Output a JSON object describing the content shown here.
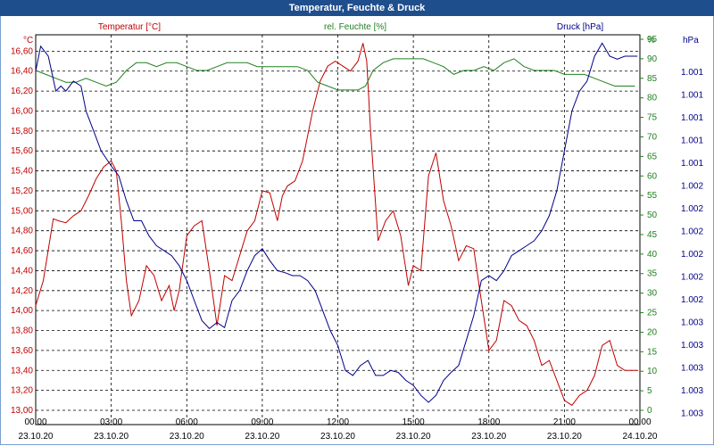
{
  "window": {
    "title": "Temperatur, Feuchte & Druck"
  },
  "colors": {
    "title_bar": "#1f4e8c",
    "temperature": "#c00000",
    "humidity": "#208020",
    "pressure": "#00008b",
    "grid": "#000000"
  },
  "chart_data": {
    "type": "line",
    "title": "Temperatur, Feuchte & Druck",
    "grid": true,
    "axes": {
      "temperature": {
        "label": "Temperatur [°C]",
        "unit": "°C",
        "side": "left",
        "ylim": [
          13.0,
          16.8
        ],
        "ticks": [
          "13,00",
          "13,20",
          "13,40",
          "13,60",
          "13,80",
          "14,00",
          "14,20",
          "14,40",
          "14,60",
          "14,80",
          "15,00",
          "15,20",
          "15,40",
          "15,60",
          "15,80",
          "16,00",
          "16,20",
          "16,40",
          "16,60"
        ]
      },
      "humidity": {
        "label": "rel. Feuchte [%]",
        "unit": "%",
        "side": "right-inner",
        "ylim": [
          0,
          95
        ],
        "ticks": [
          "0",
          "5",
          "10",
          "15",
          "20",
          "25",
          "30",
          "35",
          "40",
          "45",
          "50",
          "55",
          "60",
          "65",
          "70",
          "75",
          "80",
          "85",
          "90",
          "95"
        ]
      },
      "pressure": {
        "label": "Druck [hPa]",
        "unit": "hPa",
        "side": "right-outer",
        "ticks": [
          "1.001",
          "1.001",
          "1.001",
          "1.001",
          "1.001",
          "1.002",
          "1.002",
          "1.002",
          "1.002",
          "1.002",
          "1.002",
          "1.003",
          "1.003",
          "1.003",
          "1.003",
          "1.003"
        ]
      }
    },
    "x_ticks": [
      {
        "time": "00:00",
        "date": "23.10.20"
      },
      {
        "time": "03:00",
        "date": "23.10.20"
      },
      {
        "time": "06:00",
        "date": "23.10.20"
      },
      {
        "time": "09:00",
        "date": "23.10.20"
      },
      {
        "time": "12:00",
        "date": "23.10.20"
      },
      {
        "time": "15:00",
        "date": "23.10.20"
      },
      {
        "time": "18:00",
        "date": "23.10.20"
      },
      {
        "time": "21:00",
        "date": "23.10.20"
      },
      {
        "time": "00:00",
        "date": "24.10.20"
      }
    ],
    "x_unit": "hours since 23.10.20 00:00",
    "series": [
      {
        "name": "Temperatur [°C]",
        "axis": "temperature",
        "x": [
          0,
          0.3,
          0.7,
          0.9,
          1.2,
          1.5,
          1.8,
          2.1,
          2.4,
          2.7,
          3.0,
          3.2,
          3.4,
          3.6,
          3.8,
          4.1,
          4.4,
          4.7,
          5.0,
          5.3,
          5.5,
          5.7,
          6.0,
          6.3,
          6.6,
          6.9,
          7.2,
          7.5,
          7.8,
          8.1,
          8.4,
          8.7,
          9.0,
          9.3,
          9.6,
          9.8,
          10.0,
          10.3,
          10.6,
          11.0,
          11.3,
          11.6,
          11.9,
          12.2,
          12.5,
          12.8,
          13.0,
          13.15,
          13.3,
          13.6,
          13.9,
          14.2,
          14.5,
          14.8,
          15.0,
          15.3,
          15.6,
          15.9,
          16.2,
          16.5,
          16.8,
          17.1,
          17.4,
          17.7,
          18.0,
          18.3,
          18.6,
          18.9,
          19.2,
          19.5,
          19.8,
          20.1,
          20.4,
          20.7,
          21.0,
          21.3,
          21.6,
          21.9,
          22.2,
          22.5,
          22.8,
          23.1,
          23.4,
          23.7,
          23.9
        ],
        "y": [
          14.05,
          14.3,
          14.92,
          14.9,
          14.88,
          14.95,
          15.0,
          15.15,
          15.32,
          15.44,
          15.5,
          15.4,
          14.9,
          14.3,
          13.95,
          14.1,
          14.45,
          14.35,
          14.1,
          14.25,
          14.0,
          14.2,
          14.75,
          14.85,
          14.9,
          14.4,
          13.85,
          14.35,
          14.3,
          14.55,
          14.8,
          14.9,
          15.2,
          15.18,
          14.9,
          15.15,
          15.25,
          15.3,
          15.5,
          16.0,
          16.3,
          16.45,
          16.5,
          16.45,
          16.4,
          16.5,
          16.68,
          16.5,
          15.8,
          14.7,
          14.9,
          15.0,
          14.75,
          14.25,
          14.45,
          14.4,
          15.35,
          15.58,
          15.1,
          14.85,
          14.5,
          14.65,
          14.62,
          14.1,
          13.6,
          13.7,
          14.1,
          14.05,
          13.9,
          13.85,
          13.7,
          13.45,
          13.5,
          13.3,
          13.1,
          13.05,
          13.15,
          13.2,
          13.35,
          13.65,
          13.7,
          13.45,
          13.4,
          13.4,
          13.4
        ]
      },
      {
        "name": "rel. Feuchte [%]",
        "axis": "humidity",
        "x": [
          0,
          0.4,
          0.8,
          1.2,
          1.6,
          2.0,
          2.4,
          2.8,
          3.2,
          3.6,
          4.0,
          4.4,
          4.8,
          5.2,
          5.6,
          6.0,
          6.4,
          6.8,
          7.2,
          7.6,
          8.0,
          8.4,
          8.8,
          9.2,
          9.6,
          10.0,
          10.4,
          10.8,
          11.2,
          11.6,
          12.0,
          12.4,
          12.8,
          13.1,
          13.4,
          13.8,
          14.2,
          14.6,
          15.0,
          15.4,
          15.8,
          16.2,
          16.6,
          17.0,
          17.4,
          17.8,
          18.2,
          18.6,
          19.0,
          19.4,
          19.8,
          20.2,
          20.6,
          21.0,
          21.4,
          21.8,
          22.2,
          22.6,
          23.0,
          23.4,
          23.8
        ],
        "y": [
          87,
          86,
          85,
          84,
          84,
          85,
          84,
          83,
          84,
          87,
          89,
          89,
          88,
          89,
          89,
          88,
          87,
          87,
          88,
          89,
          89,
          89,
          88,
          88,
          88,
          88,
          88,
          87,
          84,
          83,
          82,
          82,
          82,
          83,
          87,
          89,
          90,
          90,
          90,
          90,
          89,
          88,
          86,
          87,
          87,
          88,
          87,
          89,
          90,
          88,
          87,
          87,
          87,
          86,
          86,
          86,
          85,
          84,
          83,
          83,
          83
        ]
      },
      {
        "name": "Druck [hPa]",
        "axis": "pressure",
        "x": [
          0,
          0.2,
          0.5,
          0.8,
          1.0,
          1.2,
          1.5,
          1.8,
          2.0,
          2.3,
          2.6,
          3.0,
          3.3,
          3.6,
          3.9,
          4.2,
          4.5,
          4.8,
          5.1,
          5.4,
          5.7,
          6.0,
          6.3,
          6.6,
          6.9,
          7.2,
          7.5,
          7.8,
          8.1,
          8.4,
          8.7,
          9.0,
          9.3,
          9.6,
          9.9,
          10.2,
          10.5,
          10.8,
          11.1,
          11.4,
          11.7,
          12.0,
          12.3,
          12.6,
          12.9,
          13.2,
          13.5,
          13.8,
          14.1,
          14.4,
          14.7,
          15.0,
          15.3,
          15.6,
          15.9,
          16.2,
          16.5,
          16.8,
          17.1,
          17.4,
          17.7,
          18.0,
          18.3,
          18.6,
          18.9,
          19.2,
          19.5,
          19.8,
          20.1,
          20.4,
          20.7,
          21.0,
          21.3,
          21.6,
          21.9,
          22.2,
          22.5,
          22.8,
          23.1,
          23.4,
          23.7,
          23.9
        ],
        "y": [
          16.4,
          16.65,
          16.55,
          16.2,
          16.25,
          16.2,
          16.3,
          16.25,
          16.0,
          15.8,
          15.6,
          15.45,
          15.35,
          15.1,
          14.9,
          14.9,
          14.75,
          14.65,
          14.6,
          14.55,
          14.45,
          14.3,
          14.1,
          13.9,
          13.82,
          13.88,
          13.83,
          14.1,
          14.2,
          14.4,
          14.55,
          14.62,
          14.5,
          14.4,
          14.38,
          14.35,
          14.35,
          14.3,
          14.2,
          14.0,
          13.8,
          13.65,
          13.4,
          13.35,
          13.45,
          13.5,
          13.35,
          13.35,
          13.4,
          13.38,
          13.3,
          13.25,
          13.15,
          13.08,
          13.15,
          13.3,
          13.38,
          13.45,
          13.7,
          13.95,
          14.3,
          14.35,
          14.3,
          14.4,
          14.55,
          14.6,
          14.65,
          14.7,
          14.8,
          14.95,
          15.2,
          15.6,
          16.0,
          16.2,
          16.3,
          16.55,
          16.68,
          16.55,
          16.52,
          16.55,
          16.55,
          16.55
        ],
        "note": "plotted against the temperature scale positions"
      }
    ]
  }
}
